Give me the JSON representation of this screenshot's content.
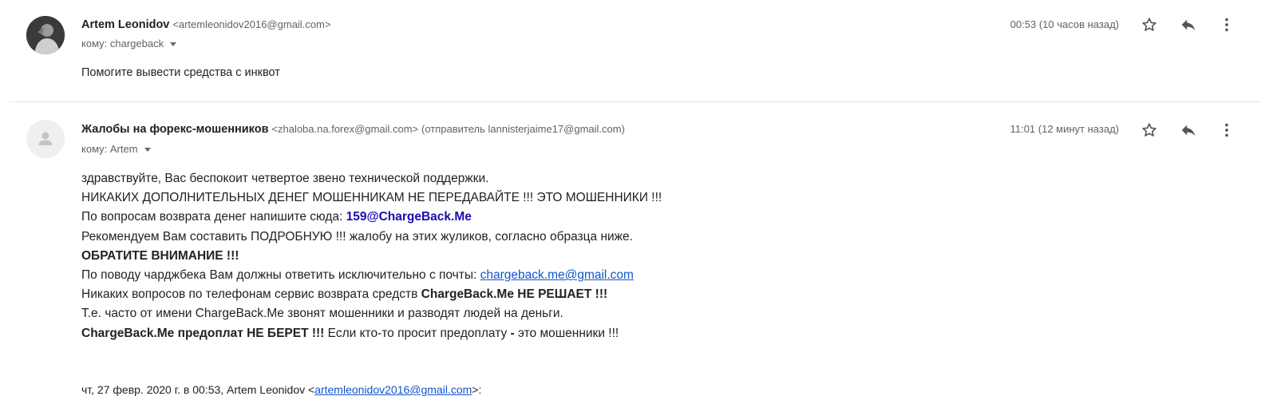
{
  "message1": {
    "sender_name": "Artem Leonidov",
    "sender_email": "<artemleonidov2016@gmail.com>",
    "to_label": "кому: chargeback",
    "time": "00:53 (10 часов назад)",
    "body": "Помогите вывести средства с инквот",
    "icons": [
      "avatar-photo",
      "star-icon",
      "reply-icon",
      "more-vert-icon"
    ]
  },
  "message2": {
    "sender_name": "Жалобы на форекс-мошенников",
    "sender_email": "<zhaloba.na.forex@gmail.com>",
    "via": "(отправитель lannisterjaime17@gmail.com)",
    "to_label": "кому: Artem",
    "time": "11:01 (12 минут назад)",
    "lines": {
      "l1": "здравствуйте, Вас беспокоит четвертое звено технической поддержки.",
      "l2": "НИКАКИХ ДОПОЛНИТЕЛЬНЫХ ДЕНЕГ МОШЕННИКАМ НЕ ПЕРЕДАВАЙТЕ !!! ЭТО МОШЕННИКИ !!!",
      "l3_text": "По вопросам возврата денег напишите сюда: ",
      "l3_email": "159@ChargeBack.Me",
      "l4": "Рекомендуем Вам составить ПОДРОБНУЮ !!! жалобу на этих жуликов, согласно образца ниже.",
      "l5": "ОБРАТИТЕ ВНИМАНИЕ !!!",
      "l6_text": "По поводу чарджбека Вам должны ответить исключительно с почты: ",
      "l6_link": "chargeback.me@gmail.com",
      "l7_text": "Никаких вопросов по телефонам сервис возврата средств ",
      "l7_bold": "ChargeBack.Me НЕ РЕШАЕТ !!!",
      "l8": "Т.е. часто от имени ChargeBack.Me звонят мошенники и разводят людей на деньги.",
      "l9_bold": "ChargeBack.Me предоплат НЕ БЕРЕТ !!!",
      "l9_text": " Если кто-то просит предоплату ",
      "l9_dash": "-",
      "l9_end": " это мошенники !!!"
    },
    "quote": {
      "prefix": "чт, 27 февр. 2020 г. в 00:53, Artem Leonidov <",
      "email": "artemleonidov2016@gmail.com",
      "suffix": ">:"
    },
    "icons": [
      "person-icon",
      "star-icon",
      "reply-icon",
      "more-vert-icon"
    ]
  }
}
